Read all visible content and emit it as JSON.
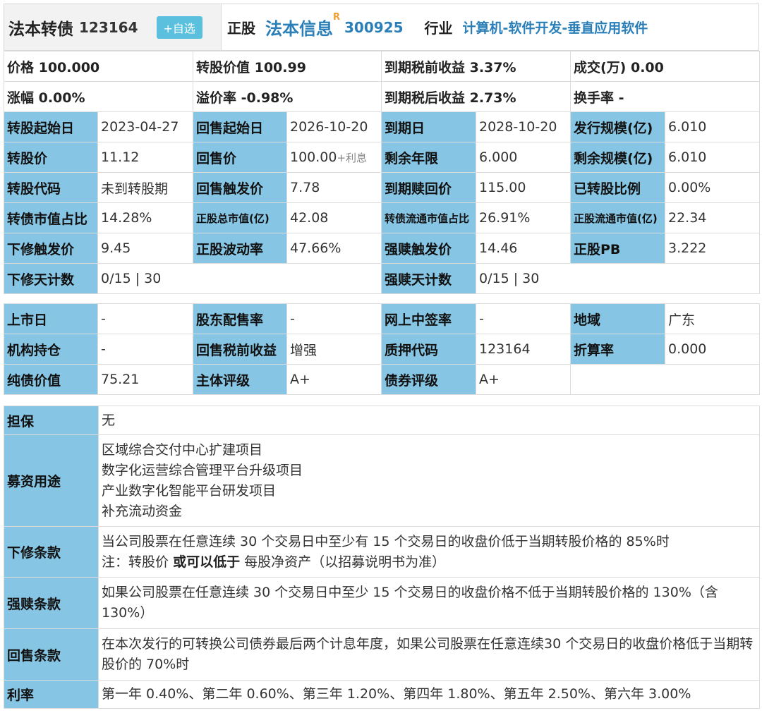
{
  "header": {
    "bond_name": "法本转债",
    "bond_code": "123164",
    "add_button": "+自选",
    "stock_label": "正股",
    "stock_name": "法本信息",
    "stock_sup": "R",
    "stock_code": "300925",
    "industry_label": "行业",
    "industry_value": "计算机-软件开发-垂直应用软件"
  },
  "summary": {
    "price": "价格 100.000",
    "conv_value": "转股价值 100.99",
    "ytm_pre": "到期税前收益 3.37%",
    "volume": "成交(万) 0.00",
    "change": "涨幅 0.00%",
    "premium": "溢价率 -0.98%",
    "ytm_post": "到期税后收益 2.73%",
    "turnover": "换手率 -"
  },
  "table1": {
    "r1": {
      "k1": "转股起始日",
      "v1": "2023-04-27",
      "k2": "回售起始日",
      "v2": "2026-10-20",
      "k3": "到期日",
      "v3": "2028-10-20",
      "k4": "发行规模(亿)",
      "v4": "6.010"
    },
    "r2": {
      "k1": "转股价",
      "v1": "11.12",
      "k2": "回售价",
      "v2": "100.00",
      "v2_suffix": "+利息",
      "k3": "剩余年限",
      "v3": "6.000",
      "k4": "剩余规模(亿)",
      "v4": "6.010"
    },
    "r3": {
      "k1": "转股代码",
      "v1": "未到转股期",
      "k2": "回售触发价",
      "v2": "7.78",
      "k3": "到期赎回价",
      "v3": "115.00",
      "k4": "已转股比例",
      "v4": "0.00%"
    },
    "r4": {
      "k1": "转债市值占比",
      "v1": "14.28%",
      "k2": "正股总市值(亿)",
      "v2": "42.08",
      "k3": "转债流通市值占比",
      "v3": "26.91%",
      "k4": "正股流通市值(亿)",
      "v4": "22.34"
    },
    "r5": {
      "k1": "下修触发价",
      "v1": "9.45",
      "k2": "正股波动率",
      "v2": "47.66%",
      "k3": "强赎触发价",
      "v3": "14.46",
      "k4": "正股PB",
      "v4": "3.222"
    },
    "r6": {
      "k1": "下修天计数",
      "v1": "0/15 | 30",
      "k3": "强赎天计数",
      "v3": "0/15 | 30"
    }
  },
  "table2": {
    "r1": {
      "k1": "上市日",
      "v1": "-",
      "k2": "股东配售率",
      "v2": "-",
      "k3": "网上中签率",
      "v3": "-",
      "k4": "地域",
      "v4": "广东"
    },
    "r2": {
      "k1": "机构持仓",
      "v1": "-",
      "k2": "回售税前收益",
      "v2": "增强",
      "k3": "质押代码",
      "v3": "123164",
      "k4": "折算率",
      "v4": "0.000"
    },
    "r3": {
      "k1": "纯债价值",
      "v1": "75.21",
      "k2": "主体评级",
      "v2": "A+",
      "k3": "债券评级",
      "v3": "A+"
    }
  },
  "terms": {
    "guarantee_label": "担保",
    "guarantee": "无",
    "use_label": "募资用途",
    "uses": [
      "区域综合交付中心扩建项目",
      "数字化运营综合管理平台升级项目",
      "产业数字化智能平台研发项目",
      "补充流动资金"
    ],
    "revise_label": "下修条款",
    "revise_line1": "当公司股票在任意连续 30 个交易日中至少有 15 个交易日的收盘价低于当期转股价格的 85%时",
    "revise_note_a": "注：转股价",
    "revise_note_b": "或可以低于",
    "revise_note_c": "每股净资产（以招募说明书为准）",
    "redeem_label": "强赎条款",
    "redeem_text": "如果公司股票在任意连续 30 个交易日中至少 15 个交易日的收盘价格不低于当期转股价格的 130%（含 130%）",
    "putback_label": "回售条款",
    "putback_text": "在本次发行的可转换公司债券最后两个计息年度，如果公司股票在任意连续30 个交易日的收盘价格低于当期转股价的 70%时",
    "rate_label": "利率",
    "rate_text": "第一年 0.40%、第二年 0.60%、第三年 1.20%、第四年 1.80%、第五年 2.50%、第六年 3.00%"
  },
  "colors": {
    "key_bg": "#86c5e3",
    "link": "#2a7fb8",
    "red": "#e02020",
    "button": "#5bc0de"
  }
}
